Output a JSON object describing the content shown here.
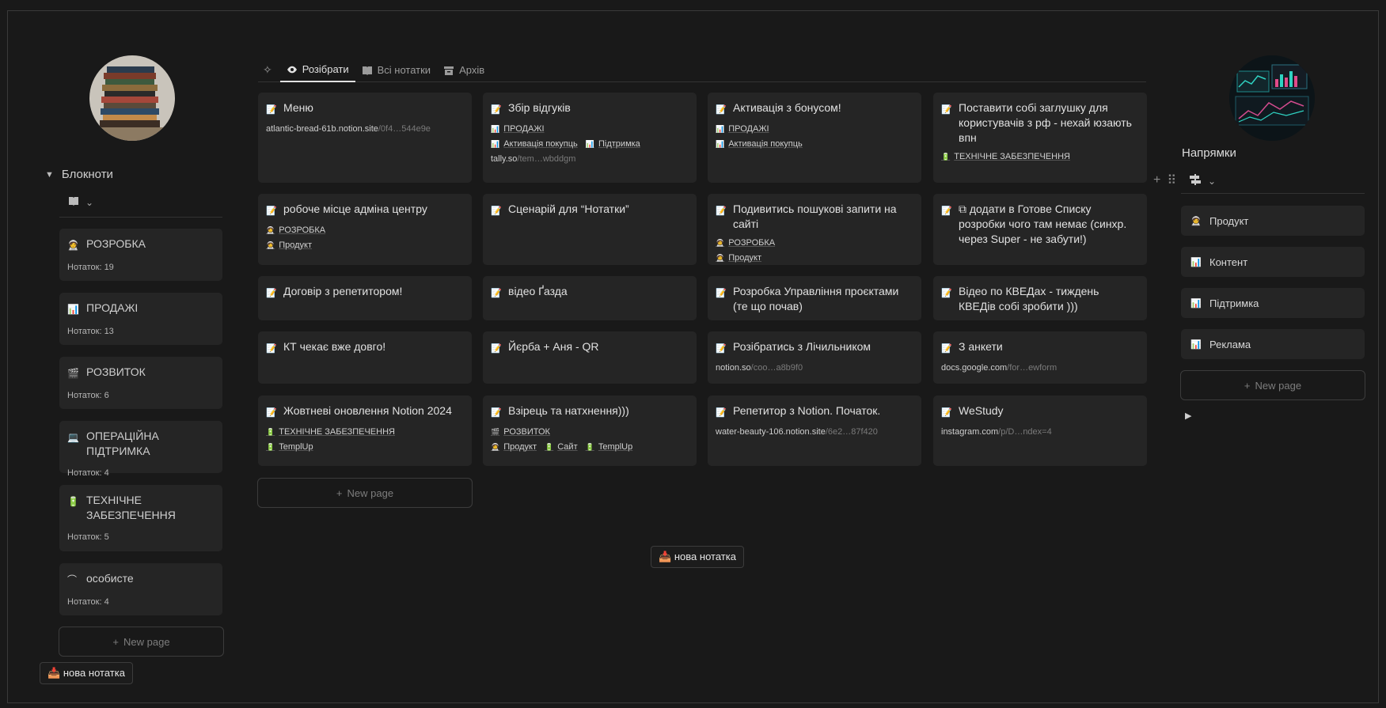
{
  "sidebar": {
    "header": "Блокноти",
    "items": [
      {
        "icon": "🧑‍🚀",
        "label": "РОЗРОБКА",
        "count": "Нотаток: 19"
      },
      {
        "icon": "📊",
        "label": "ПРОДАЖІ",
        "count": "Нотаток: 13"
      },
      {
        "icon": "🎬",
        "label": "РОЗВИТОК",
        "count": "Нотаток: 6"
      },
      {
        "icon": "💻",
        "label": "ОПЕРАЦІЙНА ПІДТРИМКА",
        "count": "Нотаток: 4"
      },
      {
        "icon": "🔋",
        "label": "ТЕХНІЧНЕ ЗАБЕЗПЕЧЕННЯ",
        "count": "Нотаток: 5"
      },
      {
        "icon": "⌒",
        "label": "особисте",
        "count": "Нотаток: 4"
      }
    ],
    "new_page": "New page",
    "new_note": "📥 нова нотатка"
  },
  "tabs": [
    {
      "label": "Розібрати",
      "icon": "eye-icon",
      "active": true
    },
    {
      "label": "Всі нотатки",
      "icon": "book-icon",
      "active": false
    },
    {
      "label": "Архів",
      "icon": "archive-icon",
      "active": false
    }
  ],
  "cards": [
    {
      "title": "Меню",
      "link": {
        "host": "atlantic-bread-61b.notion.site",
        "path": "/0f4…544e9e"
      }
    },
    {
      "title": "Збір відгуків",
      "tags": [
        [
          "ПРОДАЖІ"
        ],
        [
          "Активація покупць",
          "Підтримка"
        ]
      ],
      "link": {
        "host": "tally.so",
        "path": "/tem…wbddgm"
      }
    },
    {
      "title": "Активація з бонусом!",
      "tags": [
        [
          "ПРОДАЖІ"
        ],
        [
          "Активація покупць"
        ]
      ]
    },
    {
      "title": "Поставити собі заглушку для користувачів з рф - нехай юзають впн",
      "tags": [
        [
          "ТЕХНІЧНЕ ЗАБЕЗПЕЧЕННЯ"
        ]
      ]
    },
    {
      "title": "робоче місце адміна центру",
      "tags": [
        [
          "РОЗРОБКА"
        ],
        [
          "Продукт"
        ]
      ]
    },
    {
      "title": "Сценарій для “Нотатки”"
    },
    {
      "title": "Подивитись пошукові запити на сайті",
      "tags": [
        [
          "РОЗРОБКА"
        ],
        [
          "Продукт"
        ]
      ]
    },
    {
      "title": "⧉ додати в Готове Списку розробки чого там немає (синхр. через Super - не забути!)"
    },
    {
      "title": "Договір з репетитором!"
    },
    {
      "title": "відео Ґазда"
    },
    {
      "title": "Розробка Управління проєктами (те що почав)"
    },
    {
      "title": "Відео по КВЕДах - тиждень КВЕДів собі зробити )))"
    },
    {
      "title": "КТ чекає вже довго!"
    },
    {
      "title": "Йєрба + Аня - QR"
    },
    {
      "title": "Розібратись з Лічильником",
      "link": {
        "host": "notion.so",
        "path": "/coo…a8b9f0"
      }
    },
    {
      "title": "З анкети",
      "link": {
        "host": "docs.google.com",
        "path": "/for…ewform"
      }
    },
    {
      "title": "Жовтневі оновлення Notion 2024",
      "tags": [
        [
          "ТЕХНІЧНЕ ЗАБЕЗПЕЧЕННЯ"
        ],
        [
          "TemplUp"
        ]
      ]
    },
    {
      "title": "Взірець та натхнення)))",
      "tags": [
        [
          "РОЗВИТОК"
        ],
        [
          "Продукт",
          "Сайт",
          "TemplUp"
        ]
      ]
    },
    {
      "title": "Репетитор з Notion. Початок.",
      "link": {
        "host": "water-beauty-106.notion.site",
        "path": "/6e2…87f420"
      }
    },
    {
      "title": "WeStudy",
      "link": {
        "host": "instagram.com",
        "path": "/p/D…ndex=4"
      }
    }
  ],
  "main": {
    "new_page": "New page",
    "new_note": "📥 нова нотатка"
  },
  "right": {
    "header": "Напрямки",
    "items": [
      {
        "icon": "🧑‍🚀",
        "label": "Продукт"
      },
      {
        "icon": "📊",
        "label": "Контент"
      },
      {
        "icon": "📊",
        "label": "Підтримка"
      },
      {
        "icon": "📊",
        "label": "Реклама"
      }
    ],
    "new_page": "New page"
  }
}
